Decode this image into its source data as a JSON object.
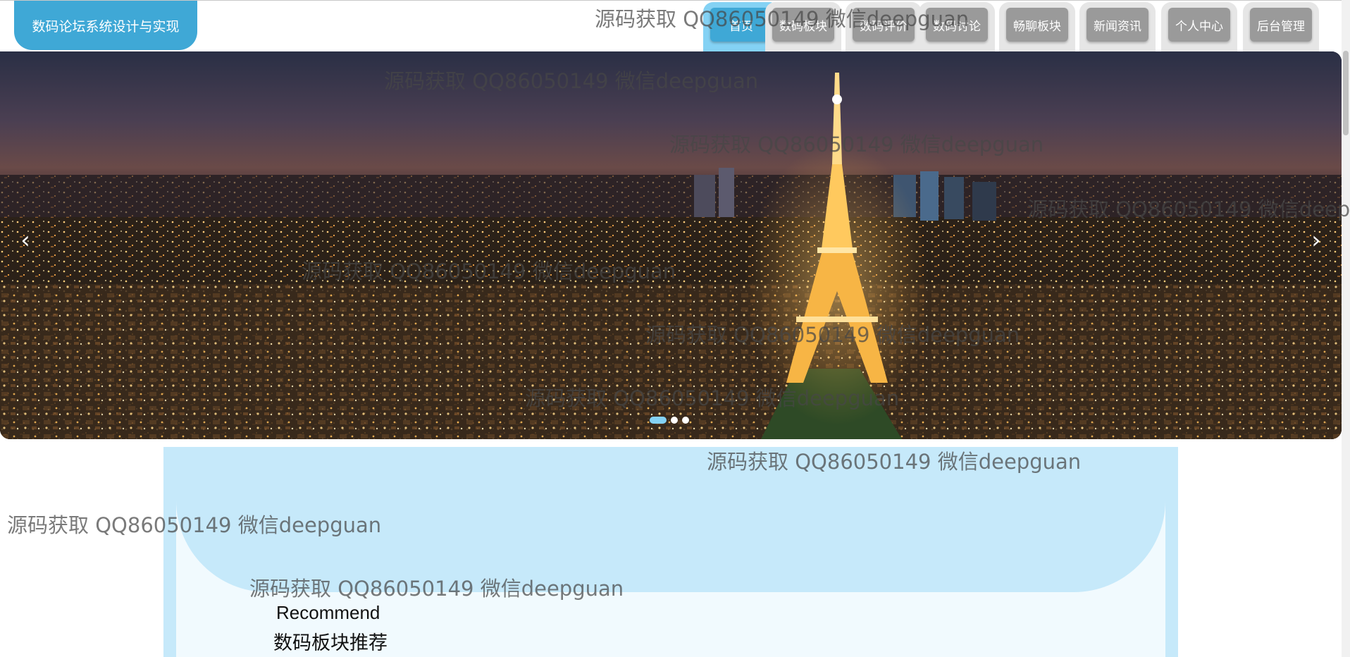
{
  "header": {
    "brand": "数码论坛系统设计与实现",
    "nav": [
      {
        "label": "首页",
        "active": true
      },
      {
        "label": "数码板块",
        "active": false
      },
      {
        "label": "数码评价",
        "active": false
      },
      {
        "label": "数码讨论",
        "active": false
      },
      {
        "label": "畅聊板块",
        "active": false
      },
      {
        "label": "新闻资讯",
        "active": false
      },
      {
        "label": "个人中心",
        "active": false
      },
      {
        "label": "后台管理",
        "active": false
      }
    ]
  },
  "carousel": {
    "image": "paris-eiffel-tower-night",
    "prev_icon": "‹",
    "next_icon": "›",
    "slides": 3,
    "active_slide": 1
  },
  "recommend": {
    "title_en": "Recommend",
    "title_cn": "数码板块推荐"
  },
  "watermark": "源码获取 QQ86050149 微信deepguan",
  "colors": {
    "accent": "#3fa8d6",
    "accent_light": "#84d2f4",
    "panel": "#c6e9fa",
    "nav_inactive": "#9a9a9a"
  }
}
